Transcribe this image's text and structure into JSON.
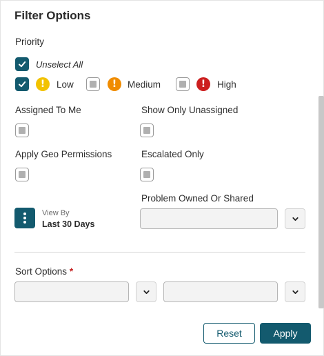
{
  "title": "Filter Options",
  "priority": {
    "heading": "Priority",
    "unselect_all": "Unselect All",
    "options": [
      {
        "label": "Low",
        "checked": true,
        "icon": "exclamation-circle-icon",
        "color": "#f2c200"
      },
      {
        "label": "Medium",
        "checked": false,
        "icon": "exclamation-circle-icon",
        "color": "#f08c00"
      },
      {
        "label": "High",
        "checked": false,
        "icon": "exclamation-circle-icon",
        "color": "#cc1f1f"
      }
    ],
    "icon_glyph": "!"
  },
  "filters": {
    "assigned_to_me": "Assigned To Me",
    "show_only_unassigned": "Show Only Unassigned",
    "apply_geo_permissions": "Apply Geo Permissions",
    "escalated_only": "Escalated Only"
  },
  "view_by": {
    "label": "View By",
    "value": "Last 30 Days"
  },
  "problem_owned": {
    "label": "Problem Owned Or Shared",
    "value": ""
  },
  "sort": {
    "label": "Sort Options",
    "required_mark": "*",
    "field1": "",
    "field2": ""
  },
  "buttons": {
    "reset": "Reset",
    "apply": "Apply"
  },
  "colors": {
    "accent": "#135a6e",
    "required": "#c41f1f"
  }
}
